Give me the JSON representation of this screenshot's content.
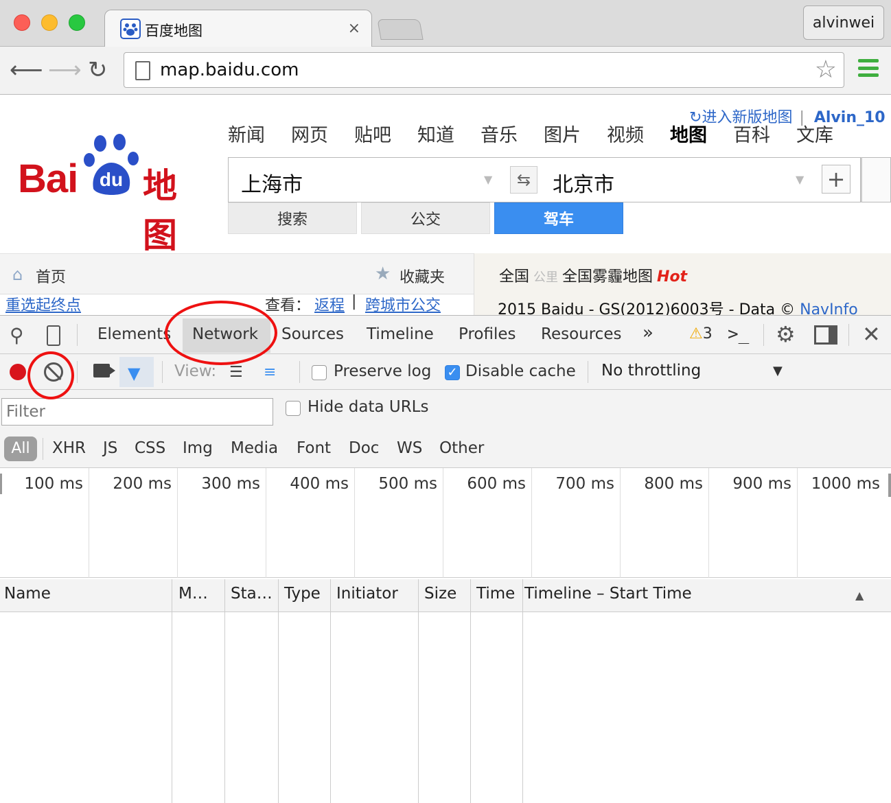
{
  "browser": {
    "tab_title": "百度地图",
    "tab_close": "×",
    "profile": "alvinwei",
    "url": "map.baidu.com"
  },
  "baidu": {
    "logo_text": "Bai",
    "logo_du": "du",
    "logo_ditu": "地图",
    "new_map_link": "进入新版地图",
    "user": "Alvin_10",
    "nav": [
      "新闻",
      "网页",
      "贴吧",
      "知道",
      "音乐",
      "图片",
      "视频",
      "地图",
      "百科",
      "文库"
    ],
    "search_from": "上海市",
    "search_to": "北京市",
    "swap": "⇆",
    "add": "+",
    "modes": [
      "搜索",
      "公交",
      "驾车"
    ],
    "home": "首页",
    "favorites": "收藏夹",
    "map_region": "全国",
    "map_faint": "公里",
    "map_smog": "全国雾霾地图",
    "map_hot": "Hot",
    "copyright_prefix": "2015 Baidu - GS(2012)6003号 - Data © ",
    "copyright_navinfo": "NavInfo",
    "reselect": "重选起终点",
    "look": "查看：",
    "return": "返程",
    "sep": "|",
    "intercity": "跨城市公交"
  },
  "devtools": {
    "tabs": [
      "Elements",
      "Network",
      "Sources",
      "Timeline",
      "Profiles",
      "Resources"
    ],
    "active_tab": "Network",
    "more": "»",
    "warnings": "3",
    "console": ">_",
    "view_label": "View:",
    "preserve_log": "Preserve log",
    "preserve_log_checked": false,
    "disable_cache": "Disable cache",
    "disable_cache_checked": true,
    "throttling": "No throttling",
    "filter_placeholder": "Filter",
    "hide_data_urls": "Hide data URLs",
    "types": [
      "All",
      "XHR",
      "JS",
      "CSS",
      "Img",
      "Media",
      "Font",
      "Doc",
      "WS",
      "Other"
    ],
    "ticks": [
      "100 ms",
      "200 ms",
      "300 ms",
      "400 ms",
      "500 ms",
      "600 ms",
      "700 ms",
      "800 ms",
      "900 ms",
      "1000 ms"
    ],
    "columns": [
      "Name",
      "M…",
      "Sta…",
      "Type",
      "Initiator",
      "Size",
      "Time",
      "Timeline – Start Time"
    ],
    "sort_arrow": "▲"
  },
  "colors": {
    "accent": "#3a8ef0",
    "record": "#d8141c",
    "annotation": "#ee1111",
    "baidu_red": "#d2121c"
  }
}
